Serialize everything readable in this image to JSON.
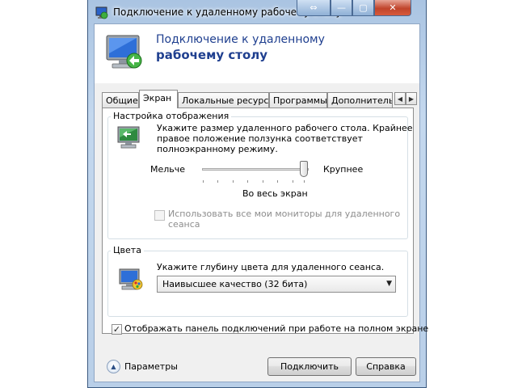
{
  "window": {
    "title": "Подключение к удаленному рабочему столу",
    "controls": {
      "resize": "⇔",
      "minimize": "—",
      "maximize": "▢",
      "close": "✕"
    }
  },
  "header": {
    "line1": "Подключение к удаленному",
    "line2": "рабочему столу"
  },
  "tabs": [
    {
      "label": "Общие",
      "active": false
    },
    {
      "label": "Экран",
      "active": true
    },
    {
      "label": "Локальные ресурсы",
      "active": false
    },
    {
      "label": "Программы",
      "active": false
    },
    {
      "label": "Дополнительно",
      "active": false
    }
  ],
  "tab_scroll": {
    "left": "◀",
    "right": "▶"
  },
  "display_settings": {
    "title": "Настройка отображения",
    "description_lines": [
      "Укажите размер удаленного рабочего стола. Крайнее",
      "правое положение ползунка соответствует",
      "полноэкранному режиму."
    ],
    "slider_min_label": "Мельче",
    "slider_max_label": "Крупнее",
    "slider_value_label": "Во весь экран",
    "slider_position": 1.0,
    "all_monitors": {
      "label_lines": [
        "Использовать все мои мониторы для удаленного",
        "сеанса"
      ],
      "checked": false,
      "enabled": false
    }
  },
  "colors": {
    "title": "Цвета",
    "description": "Укажите глубину цвета для удаленного сеанса.",
    "selected_value": "Наивысшее качество (32 бита)",
    "select_arrow": "▼"
  },
  "connection_bar": {
    "label": "Отображать панель подключений при работе на полном экране",
    "checked": true,
    "check_glyph": "✓"
  },
  "footer": {
    "options_label": "Параметры",
    "options_glyph": "▲",
    "connect_label": "Подключить",
    "help_label": "Справка"
  },
  "accent_colors": {
    "header_text": "#1f3f8f",
    "title_bar": "#aac4e2",
    "close_button": "#c0442b"
  }
}
